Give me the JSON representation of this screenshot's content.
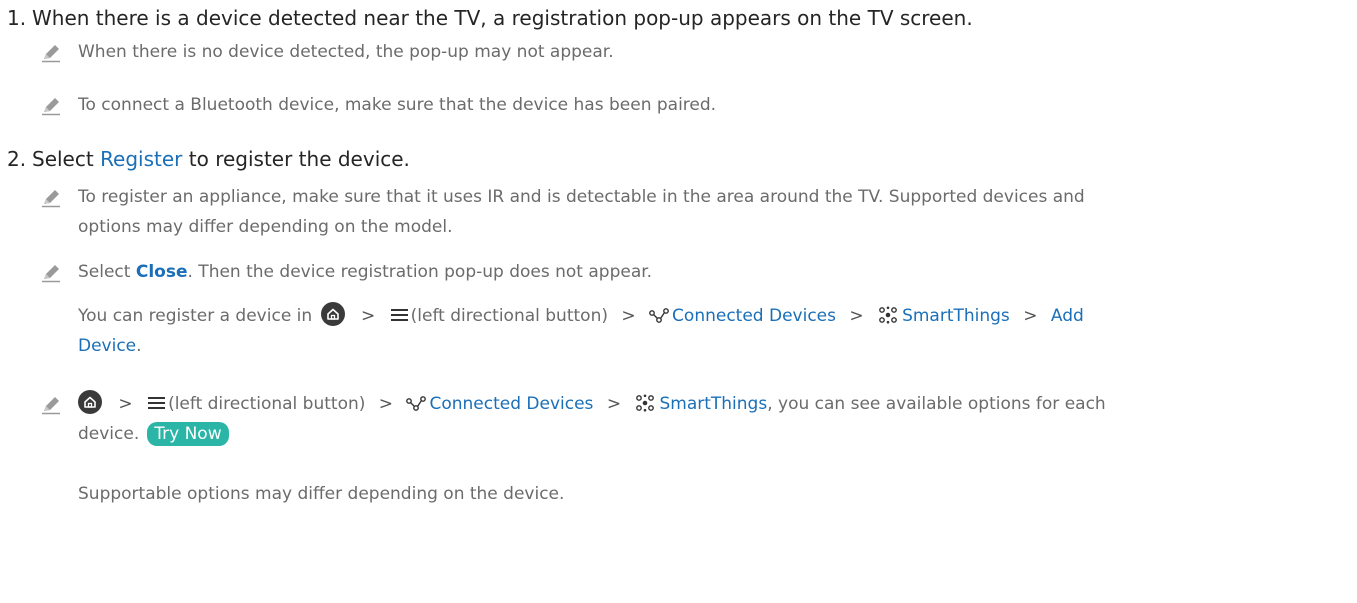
{
  "step1": {
    "number": "1.",
    "text": "When there is a device detected near the TV, a registration pop-up appears on the TV screen."
  },
  "note1": "When there is no device detected, the pop-up may not appear.",
  "note2": "To connect a Bluetooth device, make sure that the device has been paired.",
  "step2": {
    "number": "2.",
    "pre": "Select ",
    "link": "Register",
    "post": " to register the device."
  },
  "note3": {
    "line1": "To register an appliance, make sure that it uses IR and is detectable in the area around the TV. Supported devices and",
    "line2": "options may differ depending on the model."
  },
  "note4": {
    "pre": "Select ",
    "bold": "Close",
    "post": ". Then the device registration pop-up does not appear."
  },
  "sub1": {
    "pre": "You can register a device in",
    "menu_text": "(left directional button)",
    "connected": "Connected Devices",
    "smartthings": "SmartThings",
    "add": "Add",
    "device": "Device",
    "end": "."
  },
  "note5": {
    "menu_text": "(left directional button)",
    "connected": "Connected Devices",
    "smartthings": "SmartThings",
    "post": ", you can see available options for each",
    "line2": "device.",
    "try_now": "Try Now"
  },
  "sub2": "Supportable options may differ depending on the device.",
  "icons": [
    "pencil-icon",
    "home-icon",
    "menu-icon",
    "connected-devices-icon",
    "smartthings-icon",
    "chevron-right-icon"
  ],
  "colors": {
    "link": "#1a6fb8",
    "note_text": "#6b6b6b",
    "try_now_bg": "#2bb5a6",
    "body_text": "#252525"
  }
}
